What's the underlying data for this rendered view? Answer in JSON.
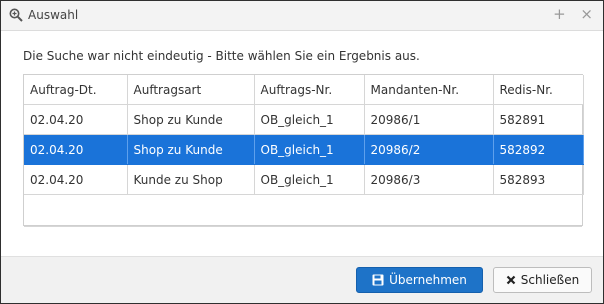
{
  "window": {
    "title": "Auswahl",
    "icon": "zoom-icon",
    "tools": [
      "+",
      "×"
    ]
  },
  "message": "Die Suche war nicht eindeutig - Bitte wählen Sie ein Ergebnis aus.",
  "table": {
    "columns": [
      "Auftrag-Dt.",
      "Auftragsart",
      "Auftrags-Nr.",
      "Mandanten-Nr.",
      "Redis-Nr."
    ],
    "rows": [
      [
        "02.04.20",
        "Shop zu Kunde",
        "OB_gleich_1",
        "20986/1",
        "582891"
      ],
      [
        "02.04.20",
        "Shop zu Kunde",
        "OB_gleich_1",
        "20986/2",
        "582892"
      ],
      [
        "02.04.20",
        "Kunde zu Shop",
        "OB_gleich_1",
        "20986/3",
        "582893"
      ]
    ],
    "selected_row": 2
  },
  "footer": {
    "accept_label": "Übernehmen",
    "close_label": "Schließen"
  },
  "colors": {
    "selection": "#1a73d9",
    "primary_button": "#1e73c8"
  }
}
